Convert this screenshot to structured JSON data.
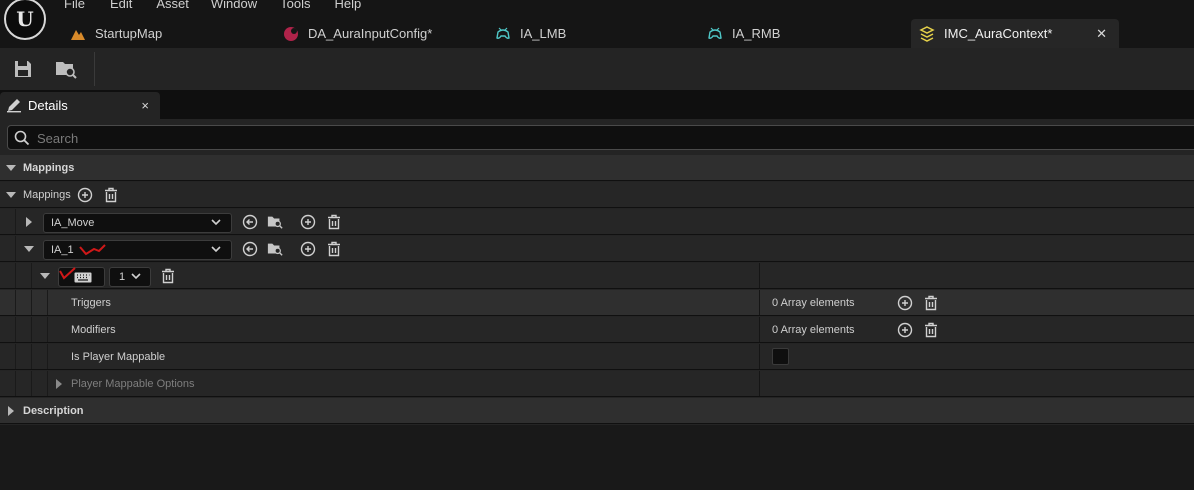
{
  "menubar": {
    "items": [
      "File",
      "Edit",
      "Asset",
      "Window",
      "Tools",
      "Help"
    ]
  },
  "tabs": [
    {
      "label": "StartupMap",
      "icon": "level-map-icon"
    },
    {
      "label": "DA_AuraInputConfig*",
      "icon": "data-asset-icon"
    },
    {
      "label": "IA_LMB",
      "icon": "input-action-icon"
    },
    {
      "label": "IA_RMB",
      "icon": "input-action-icon"
    },
    {
      "label": "IMC_AuraContext*",
      "icon": "input-mapping-context-icon",
      "active": true
    }
  ],
  "toolbar": {
    "save_icon": "save-icon",
    "browse_icon": "browse-asset-icon"
  },
  "details_tab": {
    "label": "Details",
    "close": "×"
  },
  "search": {
    "placeholder": "Search"
  },
  "sections": {
    "mappings_header": "Mappings",
    "mappings_array_label": "Mappings",
    "description_header": "Description"
  },
  "mapping_rows": [
    {
      "action": "IA_Move",
      "expanded": false
    },
    {
      "action": "IA_1",
      "expanded": true
    }
  ],
  "key_row": {
    "key_icon": "keyboard-icon",
    "index_value": "1"
  },
  "properties": {
    "triggers": {
      "label": "Triggers",
      "value": "0 Array elements"
    },
    "modifiers": {
      "label": "Modifiers",
      "value": "0 Array elements"
    },
    "is_player_mappable": {
      "label": "Is Player Mappable",
      "checked": false
    },
    "player_mappable_options": {
      "label": "Player Mappable Options"
    }
  },
  "colors": {
    "accent_annotation": "#d01818",
    "panel": "#242424",
    "background": "#151515"
  }
}
